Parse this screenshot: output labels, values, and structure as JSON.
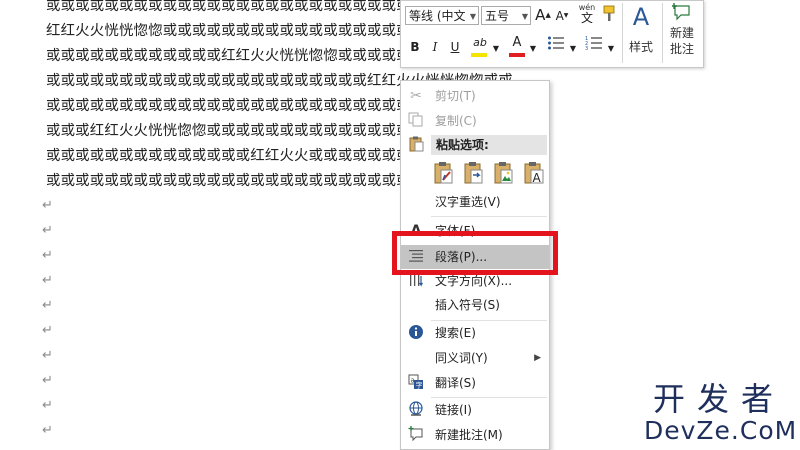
{
  "document": {
    "lines": [
      "或或或或或或或或或或或或或或或或或或或或或或或或或或",
      "红红火火恍恍惚惚或或或或或或或或或或或或或或或或或或",
      "或或或或或或或或或或或或红红火火恍恍惚惚或或或或或或",
      "或或或或或或或或或或或或或或或或或或或或或或红红火火恍恍惚惚或或",
      "或或或或或或或或或或或或或或或或或或或或或或或或或或或或或或或或",
      "或或或红红火火恍恍惚惚或或或或或或或或或或或或或或或或或或或或或",
      "或或或或或或或或或或或或或或红红火火或或或或或或或或或或或或或或",
      "或或或或或或或或或或或或或或或或或或或或或或或或或或"
    ],
    "paragraph_mark": "↵"
  },
  "minibar": {
    "font_name": "等线 (中文",
    "font_size": "五号",
    "grow_font": "A",
    "shrink_font": "A",
    "phonetic_top": "wén",
    "phonetic_bottom": "文",
    "bold": "B",
    "italic": "I",
    "underline": "U",
    "font_color_letter": "A",
    "highlight_letter": "ab",
    "styles_label": "样式",
    "styles_letter": "A",
    "new_comment_line1": "新建",
    "new_comment_line2": "批注",
    "colors": {
      "highlight": "#f5e400",
      "font": "#e02020"
    }
  },
  "context_menu": {
    "cut": "剪切(T)",
    "copy": "复制(C)",
    "paste_options": "粘贴选项:",
    "reselect": "汉字重选(V)",
    "font": "字体(F)...",
    "paragraph": "段落(P)...",
    "text_direction": "文字方向(X)...",
    "insert_symbol": "插入符号(S)",
    "search": "搜索(E)",
    "synonyms": "同义词(Y)",
    "translate": "翻译(S)",
    "link": "链接(I)",
    "new_comment": "新建批注(M)"
  },
  "watermark": {
    "cn": "开发者",
    "en": "DevZe.CoM"
  },
  "colors": {
    "red_outline": "#e3141e",
    "highlight_bg": "#c4c4c4"
  }
}
